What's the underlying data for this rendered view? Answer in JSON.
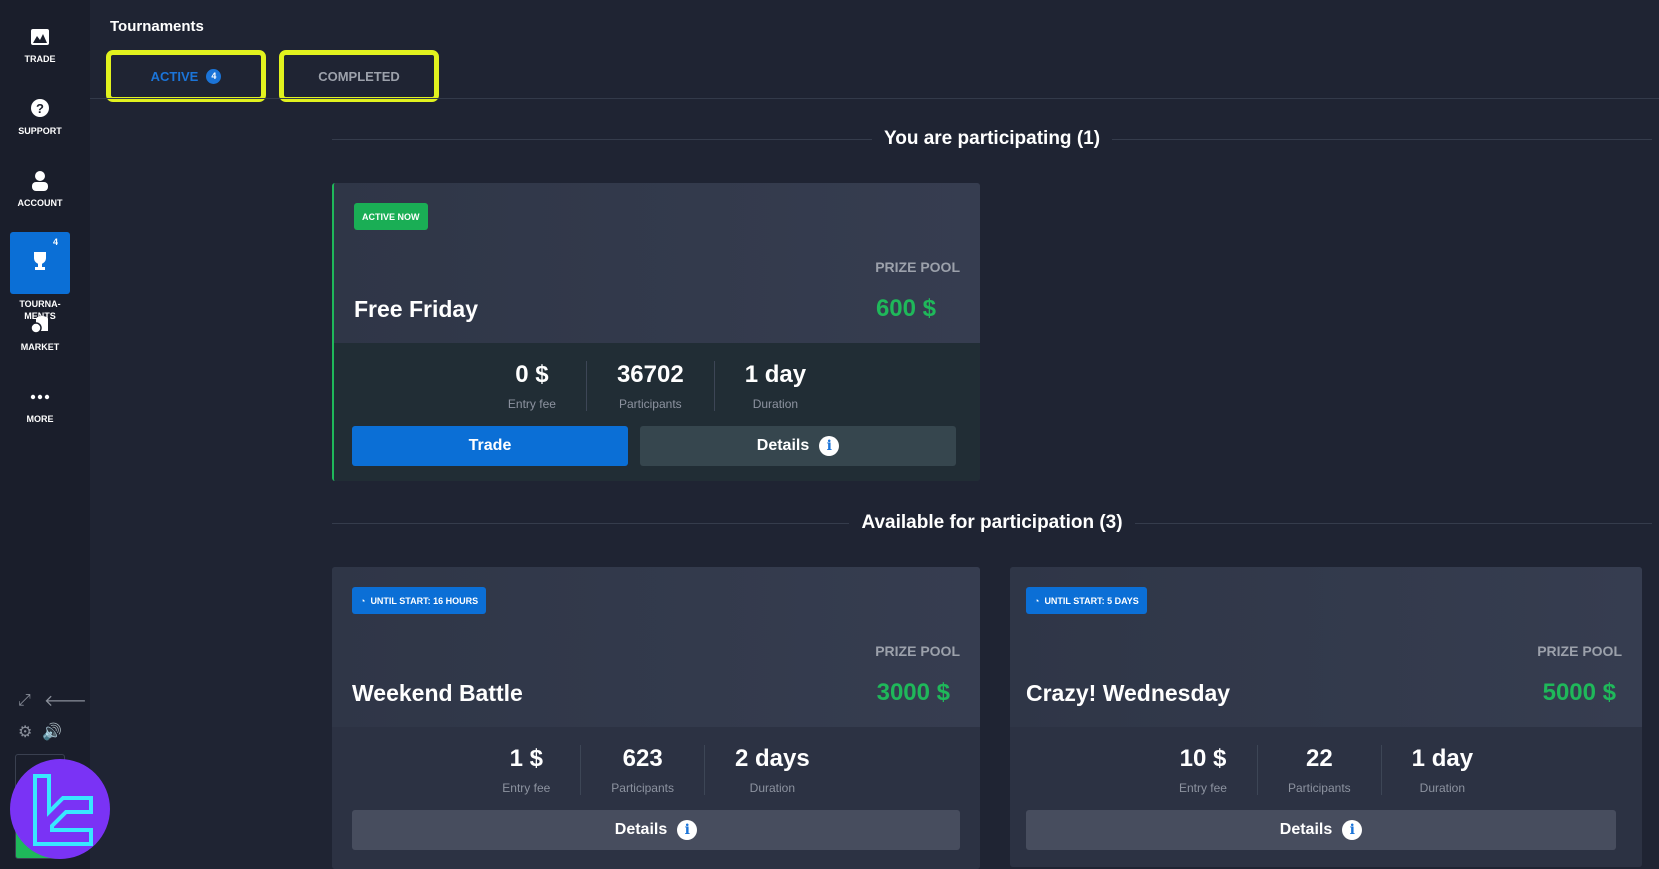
{
  "sidebar": {
    "items": [
      {
        "label": "TRADE",
        "icon": "chart-image-icon"
      },
      {
        "label": "SUPPORT",
        "icon": "question-bubble-icon"
      },
      {
        "label": "ACCOUNT",
        "icon": "user-icon"
      },
      {
        "label": "TOURNA-\nMENTS",
        "icon": "trophy-icon",
        "badge": "4"
      },
      {
        "label": "MARKET",
        "icon": "coins-icon"
      },
      {
        "label": "MORE",
        "icon": "dots-icon"
      }
    ]
  },
  "page": {
    "title": "Tournaments"
  },
  "tabs": {
    "active_label": "ACTIVE",
    "active_count": "4",
    "completed_label": "COMPLETED"
  },
  "sections": {
    "participating": "You are participating (1)",
    "available": "Available for participation (3)"
  },
  "labels": {
    "prize_pool": "PRIZE POOL",
    "entry_fee": "Entry fee",
    "participants": "Participants",
    "duration": "Duration",
    "trade": "Trade",
    "details": "Details",
    "info": "i"
  },
  "cards": [
    {
      "status": "ACTIVE NOW",
      "name": "Free Friday",
      "prize": "600 $",
      "entry_fee": "0 $",
      "participants": "36702",
      "duration": "1 day"
    },
    {
      "status": "UNTIL START: 16 HOURS",
      "name": "Weekend Battle",
      "prize": "3000 $",
      "entry_fee": "1 $",
      "participants": "623",
      "duration": "2 days"
    },
    {
      "status": "UNTIL START: 5 DAYS",
      "name": "Crazy! Wednesday",
      "prize": "5000 $",
      "entry_fee": "10 $",
      "participants": "22",
      "duration": "1 day"
    }
  ],
  "colors": {
    "accent": "#0b6fd6",
    "prize": "#1fb85a",
    "active_badge": "#1aae55",
    "highlight": "#e1f21e",
    "logo": "#7a33f5"
  }
}
